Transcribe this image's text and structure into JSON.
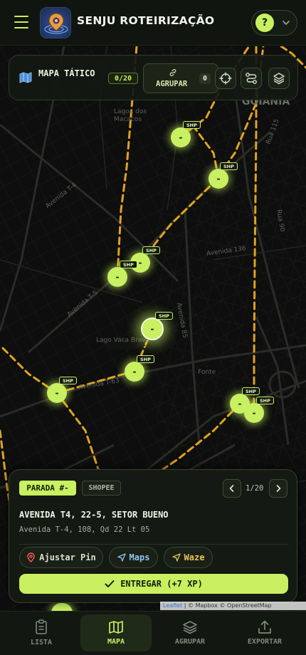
{
  "header": {
    "title": "SENJU ROTEIRIZAÇÃO",
    "help_label": "?"
  },
  "panel": {
    "title": "MAPA TÁTICO",
    "stop_count": "0/20",
    "group_label": "AGRUPAR",
    "group_count": "0"
  },
  "map": {
    "labels": [
      "Avenida T-4",
      "Avenida T-63",
      "Avenida T-5",
      "Avenida 136",
      "Avenida 85",
      "Rua 90",
      "Rua 115",
      "Lago Vaca Brava",
      "Lagoa dos Macacos",
      "Fonte",
      "GOIÂNIA"
    ],
    "markers": [
      {
        "label": "-",
        "tag": "SHP"
      },
      {
        "label": "-",
        "tag": "SHP"
      },
      {
        "label": "-",
        "tag": "SHP"
      },
      {
        "label": "-",
        "tag": "SHP"
      },
      {
        "label": "-",
        "tag": "SHP"
      },
      {
        "label": "-",
        "tag": "SHP"
      },
      {
        "label": "-",
        "tag": "SHP"
      },
      {
        "label": "-",
        "tag": "SHP"
      },
      {
        "label": "-",
        "tag": "SHP"
      }
    ],
    "attribution_prefix": "Leaflet",
    "attribution_rest": " | © Mapbox © OpenStreetMap"
  },
  "stop_card": {
    "stop_label": "PARADA #-",
    "carrier": "SHOPEE",
    "page": "1/20",
    "address_main": "AVENIDA T4, 22-5, SETOR BUENO",
    "address_detail": "Avenida T-4, 108, Qd 22 Lt 05",
    "adjust_pin_label": "Ajustar Pin",
    "maps_label": "Maps",
    "waze_label": "Waze",
    "deliver_label": "ENTREGAR (+7 XP)"
  },
  "bottom_nav": {
    "items": [
      {
        "label": "LISTA",
        "active": false
      },
      {
        "label": "MAPA",
        "active": true
      },
      {
        "label": "AGRUPAR",
        "active": false
      },
      {
        "label": "EXPORTAR",
        "active": false
      }
    ]
  },
  "colors": {
    "accent": "#c8f060",
    "route": "#e0a31f",
    "background": "#0b0c0b"
  },
  "icons": [
    "menu-icon",
    "app-logo-icon",
    "chevron-down-icon",
    "map-icon",
    "link-icon",
    "crosshair-icon",
    "route-icon",
    "layers-icon",
    "chevron-left-icon",
    "chevron-right-icon",
    "pin-icon",
    "navigation-icon",
    "waze-navigation-icon",
    "check-icon",
    "clipboard-list-icon",
    "map-fold-icon",
    "layers-stack-icon",
    "export-icon"
  ]
}
